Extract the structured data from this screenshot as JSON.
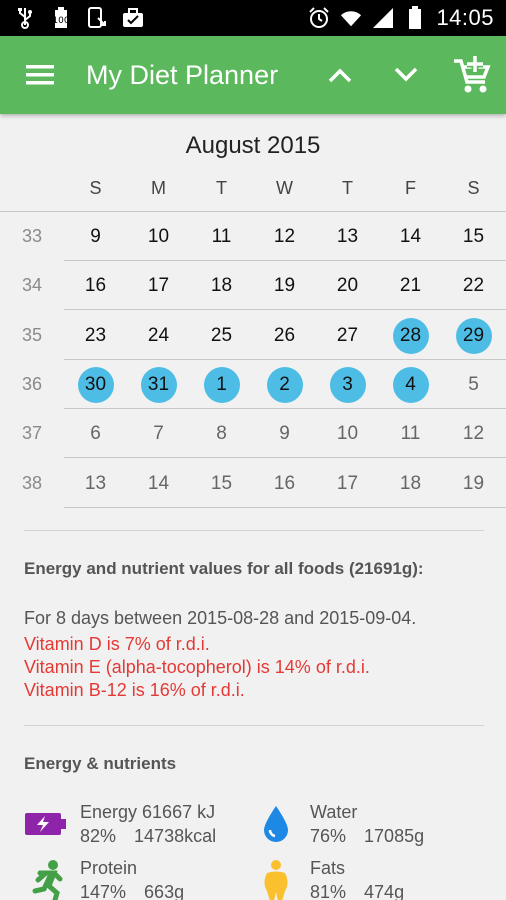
{
  "status_bar": {
    "time": "14:05",
    "left_icons": [
      "usb-icon",
      "battery-status-icon",
      "phone-download-icon",
      "briefcase-icon"
    ],
    "right_icons": [
      "alarm-icon",
      "wifi-icon",
      "signal-icon",
      "battery-icon"
    ]
  },
  "app_bar": {
    "title": "My Diet Planner",
    "icons": [
      "hamburger-menu-icon",
      "chevron-up-icon",
      "chevron-down-icon",
      "add-to-cart-icon"
    ]
  },
  "calendar": {
    "month": "August 2015",
    "weekdays": [
      "S",
      "M",
      "T",
      "W",
      "T",
      "F",
      "S"
    ],
    "weeks": [
      {
        "num": "33",
        "days": [
          {
            "d": "9",
            "t": "cur"
          },
          {
            "d": "10",
            "t": "cur"
          },
          {
            "d": "11",
            "t": "cur"
          },
          {
            "d": "12",
            "t": "cur"
          },
          {
            "d": "13",
            "t": "cur"
          },
          {
            "d": "14",
            "t": "cur"
          },
          {
            "d": "15",
            "t": "cur"
          }
        ]
      },
      {
        "num": "34",
        "days": [
          {
            "d": "16",
            "t": "cur"
          },
          {
            "d": "17",
            "t": "cur"
          },
          {
            "d": "18",
            "t": "cur"
          },
          {
            "d": "19",
            "t": "cur"
          },
          {
            "d": "20",
            "t": "cur"
          },
          {
            "d": "21",
            "t": "cur"
          },
          {
            "d": "22",
            "t": "cur"
          }
        ]
      },
      {
        "num": "35",
        "days": [
          {
            "d": "23",
            "t": "cur"
          },
          {
            "d": "24",
            "t": "cur"
          },
          {
            "d": "25",
            "t": "cur"
          },
          {
            "d": "26",
            "t": "cur"
          },
          {
            "d": "27",
            "t": "cur"
          },
          {
            "d": "28",
            "t": "sel"
          },
          {
            "d": "29",
            "t": "sel"
          }
        ]
      },
      {
        "num": "36",
        "days": [
          {
            "d": "30",
            "t": "sel"
          },
          {
            "d": "31",
            "t": "sel"
          },
          {
            "d": "1",
            "t": "sel"
          },
          {
            "d": "2",
            "t": "sel"
          },
          {
            "d": "3",
            "t": "sel"
          },
          {
            "d": "4",
            "t": "sel"
          },
          {
            "d": "5",
            "t": "next"
          }
        ]
      },
      {
        "num": "37",
        "days": [
          {
            "d": "6",
            "t": "next"
          },
          {
            "d": "7",
            "t": "next"
          },
          {
            "d": "8",
            "t": "next"
          },
          {
            "d": "9",
            "t": "next"
          },
          {
            "d": "10",
            "t": "next"
          },
          {
            "d": "11",
            "t": "next"
          },
          {
            "d": "12",
            "t": "next"
          }
        ]
      },
      {
        "num": "38",
        "days": [
          {
            "d": "13",
            "t": "next"
          },
          {
            "d": "14",
            "t": "next"
          },
          {
            "d": "15",
            "t": "next"
          },
          {
            "d": "16",
            "t": "next"
          },
          {
            "d": "17",
            "t": "next"
          },
          {
            "d": "18",
            "t": "next"
          },
          {
            "d": "19",
            "t": "next"
          }
        ]
      }
    ],
    "selected_color": "#4dbde6"
  },
  "summary": {
    "heading": "Energy and nutrient values for all foods (21691g):",
    "period": "For 8 days between 2015-08-28 and 2015-09-04.",
    "warnings": [
      "Vitamin D is 7% of r.d.i.",
      "Vitamin E (alpha-tocopherol) is 14% of r.d.i.",
      "Vitamin B-12 is 16% of r.d.i."
    ],
    "warning_color": "#e53935"
  },
  "nutrients": {
    "heading": "Energy & nutrients",
    "items": [
      {
        "name": "Energy 61667 kJ",
        "pct": "82%",
        "amount": "14738kcal",
        "icon": "battery-charging-icon",
        "color": "#8e24aa"
      },
      {
        "name": "Water",
        "pct": "76%",
        "amount": "17085g",
        "icon": "water-drop-icon",
        "color": "#1e88e5"
      },
      {
        "name": "Protein",
        "pct": "147%",
        "amount": "663g",
        "icon": "running-person-icon",
        "color": "#43a047"
      },
      {
        "name": "Fats",
        "pct": "81%",
        "amount": "474g",
        "icon": "body-figure-icon",
        "color": "#fbc02d"
      }
    ]
  },
  "theme": {
    "app_bar": "#5cb85c",
    "status_bar": "#000000"
  }
}
